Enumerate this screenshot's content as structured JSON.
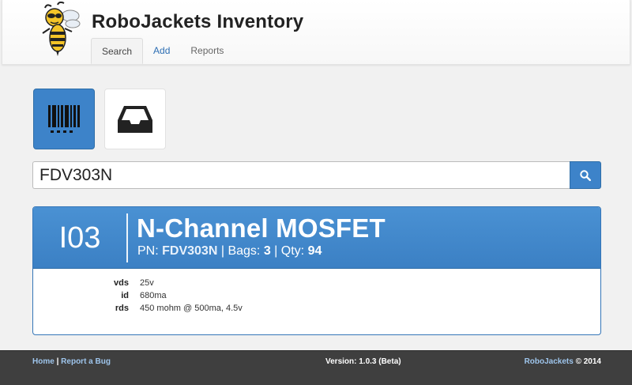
{
  "app": {
    "title": "RoboJackets Inventory"
  },
  "nav": {
    "tabs": [
      {
        "label": "Search",
        "active": true
      },
      {
        "label": "Add",
        "active": false
      },
      {
        "label": "Reports",
        "active": false
      }
    ]
  },
  "modes": {
    "barcode_icon": "barcode-icon",
    "bin_icon": "inbox-tray-icon"
  },
  "search": {
    "value": "FDV303N",
    "button_icon": "search-icon"
  },
  "result": {
    "bin": "I03",
    "name": "N-Channel MOSFET",
    "pn_label": "PN:",
    "pn": "FDV303N",
    "bags_label": "Bags:",
    "bags": "3",
    "qty_label": "Qty:",
    "qty": "94",
    "separator": "|",
    "specs": [
      {
        "key": "vds",
        "value": "25v"
      },
      {
        "key": "id",
        "value": "680ma"
      },
      {
        "key": "rds",
        "value": "450 mohm @ 500ma, 4.5v"
      }
    ]
  },
  "footer": {
    "home": "Home",
    "sep": "|",
    "report_bug": "Report a Bug",
    "version": "Version: 1.0.3 (Beta)",
    "brand": "RoboJackets",
    "copyright": "© 2014"
  },
  "colors": {
    "accent": "#3d83c9",
    "footer_bg": "#3f3f3f",
    "link": "#2d6eb3"
  }
}
